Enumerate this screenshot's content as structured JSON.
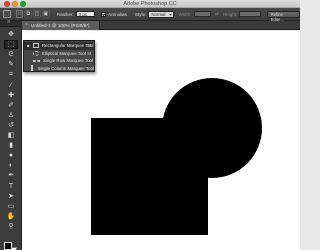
{
  "window": {
    "title": "Adobe Photoshop CC"
  },
  "options_bar": {
    "feather_label": "Feather:",
    "feather_value": "0 px",
    "anti_alias_label": "Anti-alias",
    "style_label": "Style:",
    "style_value": "Normal",
    "width_label": "Width:",
    "height_label": "Height:",
    "refine_edge_label": "Refine Edge..."
  },
  "document_tab": {
    "close_glyph": "×",
    "title": "Untitled-1 @ 100% (RGB/8*)"
  },
  "tools": [
    {
      "name": "move-tool",
      "glyph": "✥"
    },
    {
      "name": "rectangular-marquee-tool",
      "glyph": "⬚"
    },
    {
      "name": "lasso-tool",
      "glyph": "ᘓ"
    },
    {
      "name": "quick-selection-tool",
      "glyph": "✎"
    },
    {
      "name": "crop-tool",
      "glyph": "⌗"
    },
    {
      "name": "eyedropper-tool",
      "glyph": "⁄"
    },
    {
      "name": "spot-healing-tool",
      "glyph": "✚"
    },
    {
      "name": "brush-tool",
      "glyph": "✐"
    },
    {
      "name": "clone-stamp-tool",
      "glyph": "♙"
    },
    {
      "name": "history-brush-tool",
      "glyph": "↺"
    },
    {
      "name": "eraser-tool",
      "glyph": "◧"
    },
    {
      "name": "gradient-tool",
      "glyph": "▮"
    },
    {
      "name": "blur-tool",
      "glyph": "●"
    },
    {
      "name": "dodge-tool",
      "glyph": "◐"
    },
    {
      "name": "pen-tool",
      "glyph": "✒"
    },
    {
      "name": "type-tool",
      "glyph": "T"
    },
    {
      "name": "path-selection-tool",
      "glyph": "➤"
    },
    {
      "name": "rectangle-tool",
      "glyph": "▭"
    },
    {
      "name": "hand-tool",
      "glyph": "✋"
    },
    {
      "name": "zoom-tool",
      "glyph": "⚲"
    }
  ],
  "marquee_flyout": {
    "items": [
      {
        "label": "Rectangular Marquee Tool",
        "key": "M",
        "selected": true
      },
      {
        "label": "Elliptical Marquee Tool",
        "key": "M",
        "selected": false
      },
      {
        "label": "Single Row Marquee Tool",
        "key": "",
        "selected": false
      },
      {
        "label": "Single Column Marquee Tool",
        "key": "",
        "selected": false
      }
    ]
  },
  "colors": {
    "foreground": "#000000",
    "background": "#ffffff",
    "shape_fill": "#000000",
    "ui_dark": "#3c3c3c"
  }
}
